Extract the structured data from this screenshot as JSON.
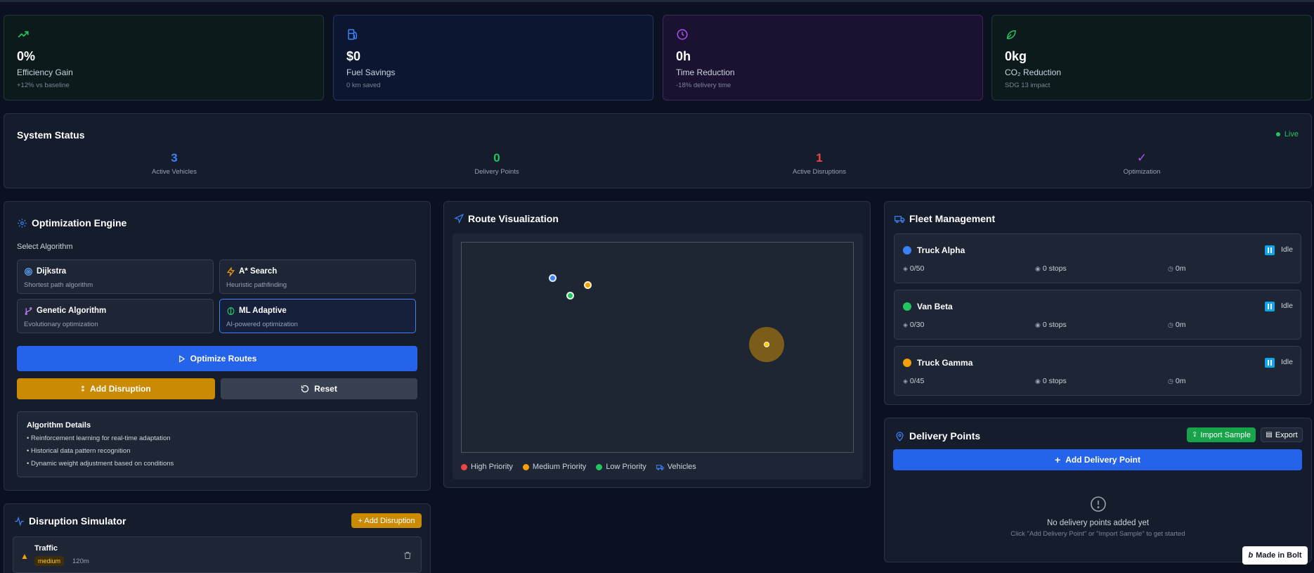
{
  "stats": [
    {
      "value": "0%",
      "label": "Efficiency Gain",
      "sub": "+12% vs baseline",
      "icon": "trending-up-icon",
      "color": "#22c55e"
    },
    {
      "value": "$0",
      "label": "Fuel Savings",
      "sub": "0 km saved",
      "icon": "fuel-icon",
      "color": "#3b82f6"
    },
    {
      "value": "0h",
      "label": "Time Reduction",
      "sub": "-18% delivery time",
      "icon": "clock-icon",
      "color": "#a855f7"
    },
    {
      "value": "0kg",
      "label": "CO₂ Reduction",
      "sub": "SDG 13 impact",
      "icon": "leaf-icon",
      "color": "#22c55e"
    }
  ],
  "system_status": {
    "title": "System Status",
    "live": "Live",
    "items": [
      {
        "value": "3",
        "caption": "Active Vehicles",
        "color": "#3b82f6"
      },
      {
        "value": "0",
        "caption": "Delivery Points",
        "color": "#22c55e"
      },
      {
        "value": "1",
        "caption": "Active Disruptions",
        "color": "#ef4444"
      },
      {
        "value": "✓",
        "caption": "Optimization",
        "color": "#a855f7"
      }
    ]
  },
  "optimization": {
    "title": "Optimization Engine",
    "select_label": "Select Algorithm",
    "algorithms": [
      {
        "name": "Dijkstra",
        "desc": "Shortest path algorithm",
        "icon": "target-icon"
      },
      {
        "name": "A* Search",
        "desc": "Heuristic pathfinding",
        "icon": "zap-icon"
      },
      {
        "name": "Genetic Algorithm",
        "desc": "Evolutionary optimization",
        "icon": "branch-icon"
      },
      {
        "name": "ML Adaptive",
        "desc": "AI-powered optimization",
        "icon": "brain-icon"
      }
    ],
    "selected": "ML Adaptive",
    "optimize_label": "Optimize Routes",
    "add_disruption_label": "Add Disruption",
    "reset_label": "Reset",
    "details_title": "Algorithm Details",
    "details": [
      "• Reinforcement learning for real-time adaptation",
      "• Historical data pattern recognition",
      "• Dynamic weight adjustment based on conditions"
    ]
  },
  "route": {
    "title": "Route Visualization",
    "legend": [
      {
        "label": "High Priority",
        "color": "#ef4444"
      },
      {
        "label": "Medium Priority",
        "color": "#f59e0b"
      },
      {
        "label": "Low Priority",
        "color": "#22c55e"
      },
      {
        "label": "Vehicles",
        "color": "#3b82f6"
      }
    ]
  },
  "fleet": {
    "title": "Fleet Management",
    "vehicles": [
      {
        "name": "Truck Alpha",
        "color": "#3b82f6",
        "status": "Idle",
        "load": "0/50",
        "stops": "0 stops",
        "time": "0m"
      },
      {
        "name": "Van Beta",
        "color": "#22c55e",
        "status": "Idle",
        "load": "0/30",
        "stops": "0 stops",
        "time": "0m"
      },
      {
        "name": "Truck Gamma",
        "color": "#f59e0b",
        "status": "Idle",
        "load": "0/45",
        "stops": "0 stops",
        "time": "0m"
      }
    ]
  },
  "delivery": {
    "title": "Delivery Points",
    "import_label": "Import Sample",
    "export_label": "Export",
    "add_label": "Add Delivery Point",
    "empty_title": "No delivery points added yet",
    "empty_sub": "Click \"Add Delivery Point\" or \"Import Sample\" to get started"
  },
  "disruption": {
    "title": "Disruption Simulator",
    "add_label": "+ Add Disruption",
    "items": [
      {
        "name": "Traffic",
        "severity": "medium",
        "duration": "120m"
      }
    ]
  },
  "badge": {
    "label": "Made in Bolt"
  }
}
